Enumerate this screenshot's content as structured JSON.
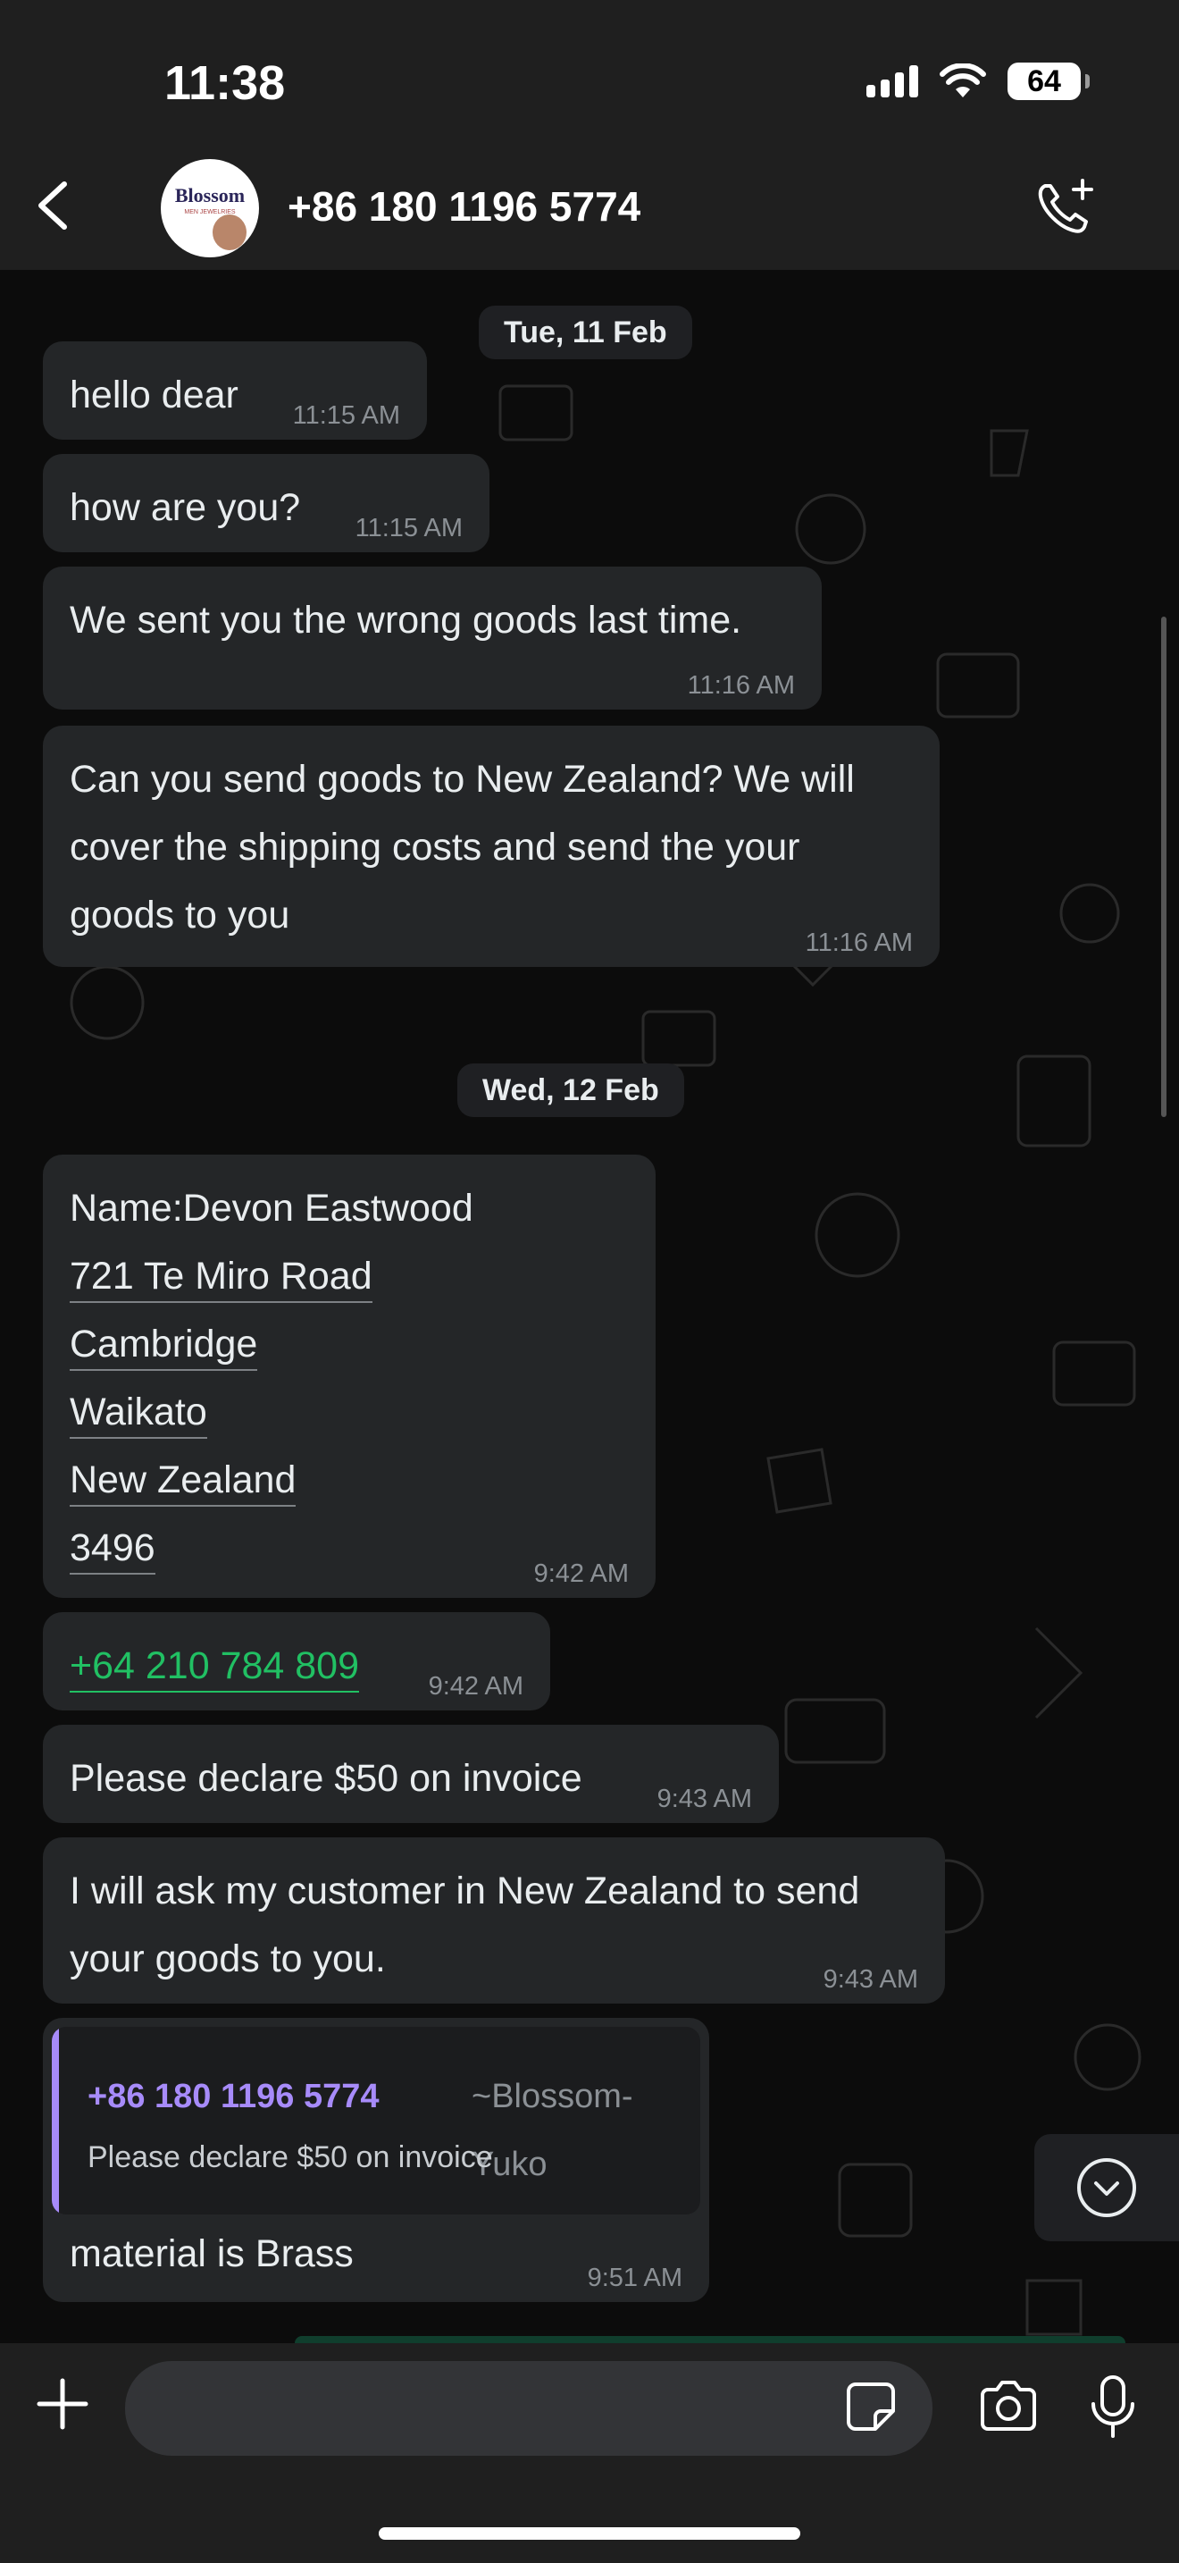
{
  "status_bar": {
    "time": "11:38",
    "battery": "64"
  },
  "header": {
    "contact": "+86 180 1196 5774"
  },
  "avatar": {
    "brand": "Blossom",
    "sub": "MEN JEWELRIES"
  },
  "messages": {
    "d1": "Tue, 11 Feb",
    "m1": {
      "text": "hello dear",
      "time": "11:15 AM"
    },
    "m2": {
      "text": "how are you?",
      "time": "11:15 AM"
    },
    "m3": {
      "text": "We sent you the wrong goods last time.",
      "time": "11:16 AM"
    },
    "m4": {
      "text": "Can you send goods to New Zealand? We will\ncover the shipping costs and send the your\ngoods to you",
      "time": "11:16 AM"
    },
    "d2": "Wed, 12 Feb",
    "m5": {
      "name": "Name:Devon Eastwood",
      "line1": "721 Te Miro Road",
      "line2": "Cambridge",
      "line3": "Waikato",
      "line4": "New Zealand",
      "line5": "3496",
      "time": "9:42 AM"
    },
    "m6": {
      "phone": "+64 210 784 809",
      "time": "9:42 AM"
    },
    "m7": {
      "text": "Please declare $50 on invoice",
      "time": "9:43 AM"
    },
    "m8": {
      "text": "I will ask my customer in New Zealand to send\nyour goods to you.",
      "time": "9:43 AM"
    },
    "m9": {
      "quote_name": "+86 180 1196 5774",
      "quote_alias": "~Blossom-Yuko",
      "quote_text": "Please declare $50 on invoice",
      "text": "material is Brass",
      "time": "9:51 AM"
    }
  },
  "composer": {
    "placeholder": ""
  },
  "colors": {
    "accent_green": "#21c063",
    "quote_purple": "#a78bfa",
    "bubble": "#242628"
  }
}
